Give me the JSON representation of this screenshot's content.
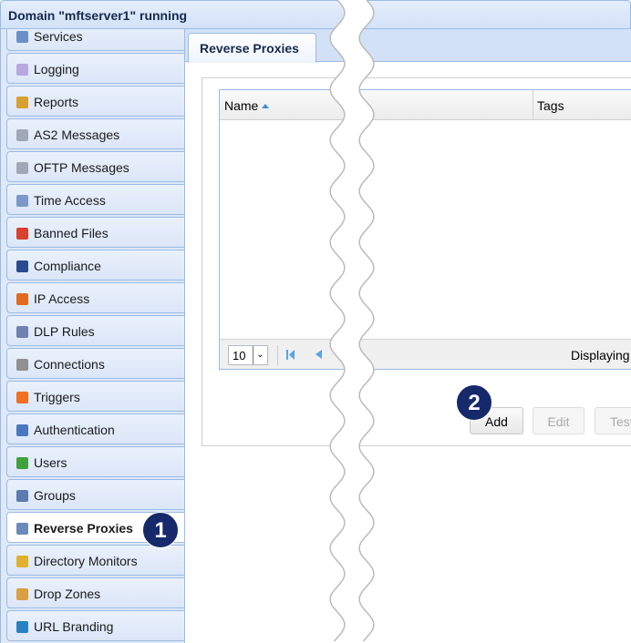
{
  "header": {
    "title": "Domain \"mftserver1\" running"
  },
  "sidebar": {
    "items": [
      {
        "label": "Services",
        "icon": "services-icon",
        "color": "#6b8fc7"
      },
      {
        "label": "Logging",
        "icon": "speech-bubble-icon",
        "color": "#b8a8e0"
      },
      {
        "label": "Reports",
        "icon": "bar-chart-icon",
        "color": "#d8a030"
      },
      {
        "label": "AS2 Messages",
        "icon": "messages-icon",
        "color": "#a0a8b8"
      },
      {
        "label": "OFTP Messages",
        "icon": "messages-icon",
        "color": "#a0a8b8"
      },
      {
        "label": "Time Access",
        "icon": "clock-icon",
        "color": "#7a98c8"
      },
      {
        "label": "Banned Files",
        "icon": "banned-file-icon",
        "color": "#d84030"
      },
      {
        "label": "Compliance",
        "icon": "compliance-user-icon",
        "color": "#2a4a90"
      },
      {
        "label": "IP Access",
        "icon": "firewall-icon",
        "color": "#e06a20"
      },
      {
        "label": "DLP Rules",
        "icon": "shield-icon",
        "color": "#7080b0"
      },
      {
        "label": "Connections",
        "icon": "connections-icon",
        "color": "#909090"
      },
      {
        "label": "Triggers",
        "icon": "fire-icon",
        "color": "#f07020"
      },
      {
        "label": "Authentication",
        "icon": "id-card-icon",
        "color": "#4a78c0"
      },
      {
        "label": "Users",
        "icon": "user-icon",
        "color": "#40a040"
      },
      {
        "label": "Groups",
        "icon": "group-icon",
        "color": "#5a7ab0"
      },
      {
        "label": "Reverse Proxies",
        "icon": "network-computers-icon",
        "color": "#6a8ab8",
        "selected": true
      },
      {
        "label": "Directory Monitors",
        "icon": "folder-clock-icon",
        "color": "#e0b030"
      },
      {
        "label": "Drop Zones",
        "icon": "box-icon",
        "color": "#d8a040"
      },
      {
        "label": "URL Branding",
        "icon": "globe-icon",
        "color": "#2a80c0"
      }
    ]
  },
  "main": {
    "tab": "Reverse Proxies",
    "grid": {
      "columns": [
        "Name",
        "Tags"
      ],
      "sort": "ascending",
      "page_size": "10",
      "display_text": "Displaying"
    },
    "buttons": {
      "add": "Add",
      "edit": "Edit",
      "test": "Test"
    }
  },
  "callouts": [
    "1",
    "2"
  ],
  "colors": {
    "accent": "#99bbe8",
    "badge": "#16296b"
  }
}
